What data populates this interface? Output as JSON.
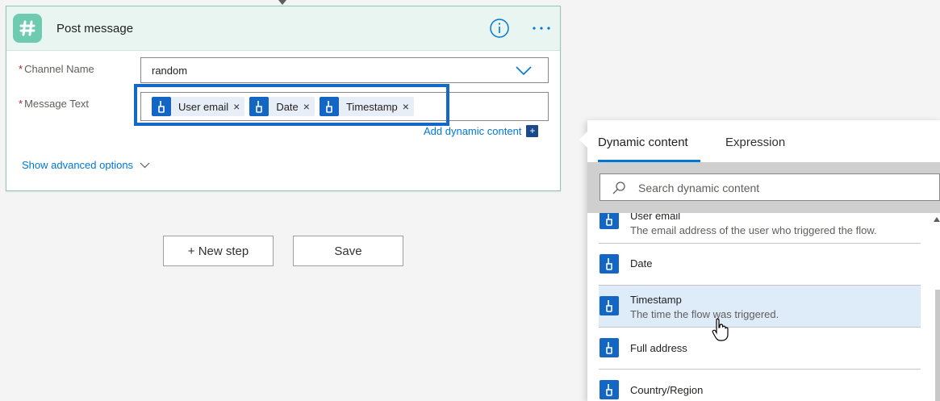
{
  "card": {
    "title": "Post message",
    "channel_label": "Channel Name",
    "channel_value": "random",
    "message_label": "Message Text",
    "required_mark": "*",
    "tokens": [
      {
        "label": "User email",
        "remove": "×"
      },
      {
        "label": "Date",
        "remove": "×"
      },
      {
        "label": "Timestamp",
        "remove": "×"
      }
    ],
    "add_dynamic_label": "Add dynamic content",
    "add_dynamic_plus": "+",
    "show_advanced_label": "Show advanced options"
  },
  "actions": {
    "new_step_label": "+ New step",
    "save_label": "Save"
  },
  "panel": {
    "tab_dynamic": "Dynamic content",
    "tab_expression": "Expression",
    "search_placeholder": "Search dynamic content",
    "items": [
      {
        "name": "User email",
        "desc": "The email address of the user who triggered the flow."
      },
      {
        "name": "Date",
        "desc": ""
      },
      {
        "name": "Timestamp",
        "desc": "The time the flow was triggered."
      },
      {
        "name": "Full address",
        "desc": ""
      },
      {
        "name": "Country/Region",
        "desc": ""
      }
    ]
  },
  "colors": {
    "accent": "#0078d4",
    "token_icon": "#1466c4",
    "highlight_border": "#1368c8",
    "slack_green": "#6ecbb0"
  },
  "icons": {
    "card": "slack-hash-icon",
    "token": "hand-tap-icon",
    "info": "info-icon",
    "more": "more-dots-icon",
    "search": "search-icon"
  }
}
